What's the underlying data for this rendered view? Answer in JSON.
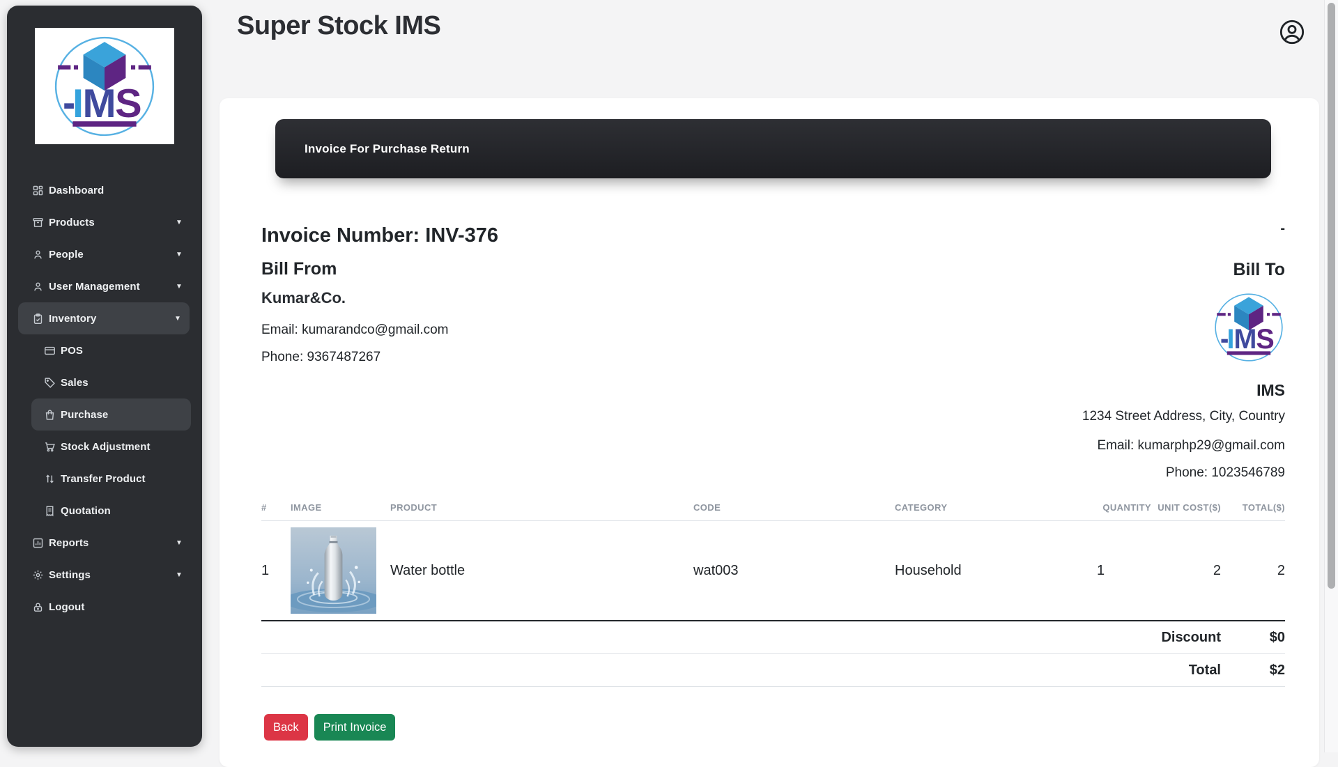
{
  "app": {
    "title": "Super Stock IMS"
  },
  "sidebar": {
    "logo_alt": "IMS logo",
    "items": [
      {
        "label": "Dashboard",
        "icon": "dashboard-icon"
      },
      {
        "label": "Products",
        "icon": "products-icon",
        "chevron": "▼"
      },
      {
        "label": "People",
        "icon": "people-icon",
        "chevron": "▼"
      },
      {
        "label": "User Management",
        "icon": "user-management-icon",
        "chevron": "▼"
      },
      {
        "label": "Inventory",
        "icon": "inventory-icon",
        "chevron": "▼",
        "active": true
      },
      {
        "label": "POS",
        "icon": "pos-icon",
        "sub": true
      },
      {
        "label": "Sales",
        "icon": "sales-icon",
        "sub": true
      },
      {
        "label": "Purchase",
        "icon": "purchase-icon",
        "sub": true,
        "active": true
      },
      {
        "label": "Stock Adjustment",
        "icon": "stock-adjustment-icon",
        "sub": true
      },
      {
        "label": "Transfer Product",
        "icon": "transfer-product-icon",
        "sub": true
      },
      {
        "label": "Quotation",
        "icon": "quotation-icon",
        "sub": true
      },
      {
        "label": "Reports",
        "icon": "reports-icon",
        "chevron": "▼"
      },
      {
        "label": "Settings",
        "icon": "settings-icon",
        "chevron": "▼"
      },
      {
        "label": "Logout",
        "icon": "logout-icon"
      }
    ]
  },
  "banner": {
    "title": "Invoice For Purchase Return"
  },
  "invoice": {
    "number_line": "Invoice Number: INV-376",
    "dash": "-",
    "bill_from": {
      "heading": "Bill From",
      "company": "Kumar&Co.",
      "email": "Email: kumarandco@gmail.com",
      "phone": "Phone: 9367487267"
    },
    "bill_to": {
      "heading": "Bill To",
      "company": "IMS",
      "address": "1234 Street Address, City, Country",
      "email": "Email: kumarphp29@gmail.com",
      "phone": "Phone: 1023546789"
    }
  },
  "table": {
    "headers": [
      "#",
      "IMAGE",
      "PRODUCT",
      "CODE",
      "CATEGORY",
      "QUANTITY",
      "UNIT COST($)",
      "TOTAL($)"
    ],
    "rows": [
      {
        "index": "1",
        "image": "water-bottle-photo",
        "product": "Water bottle",
        "code": "wat003",
        "category": "Household",
        "quantity": "1",
        "unit_cost": "2",
        "total": "2"
      }
    ],
    "summary": {
      "discount_label": "Discount",
      "discount_value": "$0",
      "total_label": "Total",
      "total_value": "$2"
    }
  },
  "actions": {
    "back_label": "Back",
    "print_label": "Print Invoice"
  },
  "colors": {
    "danger": "#dc3545",
    "success": "#198754",
    "sidebar_bg": "#2b2d31",
    "banner_bg": "#212226",
    "brand_blue": "#35a3dd",
    "brand_indigo": "#3f4a9e",
    "brand_purple": "#5e2583"
  }
}
